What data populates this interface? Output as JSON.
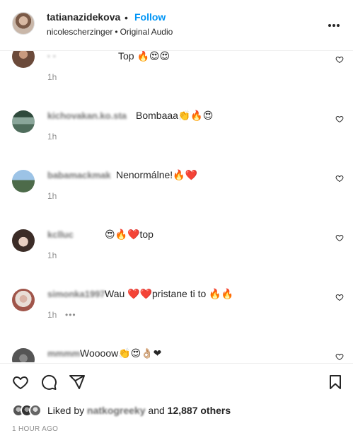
{
  "header": {
    "username": "tatianazidekova",
    "separator": "•",
    "follow_label": "Follow",
    "audio_artist": "nicolescherzinger",
    "audio_separator": "•",
    "audio_label": "Original Audio",
    "more_icon": "more-options-icon"
  },
  "comments": [
    {
      "username": "·  ·",
      "text": "Top 🔥😍😍",
      "time": "1h",
      "avatar_color": "#6b4a3a"
    },
    {
      "username": "kichovakan.ko.sta",
      "text": "Bombaaa👏🔥😍",
      "time": "1h",
      "avatar_color": "#4f6d5c"
    },
    {
      "username": "babamackmak",
      "text": "Nenormálne!🔥❤️",
      "time": "1h",
      "avatar_color": "#6d8aa6"
    },
    {
      "username": "kclluc",
      "text": "😍🔥❤️top",
      "time": "1h",
      "avatar_color": "#3b2c27"
    },
    {
      "username": "simonka1997",
      "text": "Wau ❤️❤️pristane ti to 🔥🔥",
      "time": "1h",
      "reply_more": "•••",
      "avatar_color": "#a0554a"
    },
    {
      "username": "mmmm",
      "text": "Woooow👏😍👌🏼❤",
      "time": "",
      "avatar_color": "#555"
    }
  ],
  "actions": {
    "like_icon": "heart-icon",
    "comment_icon": "comment-icon",
    "share_icon": "share-icon",
    "save_icon": "bookmark-icon"
  },
  "likes": {
    "prefix": "Liked by",
    "user": "natkogreeky",
    "middle": "and",
    "count": "12,887 others"
  },
  "timestamp": "1 HOUR AGO"
}
